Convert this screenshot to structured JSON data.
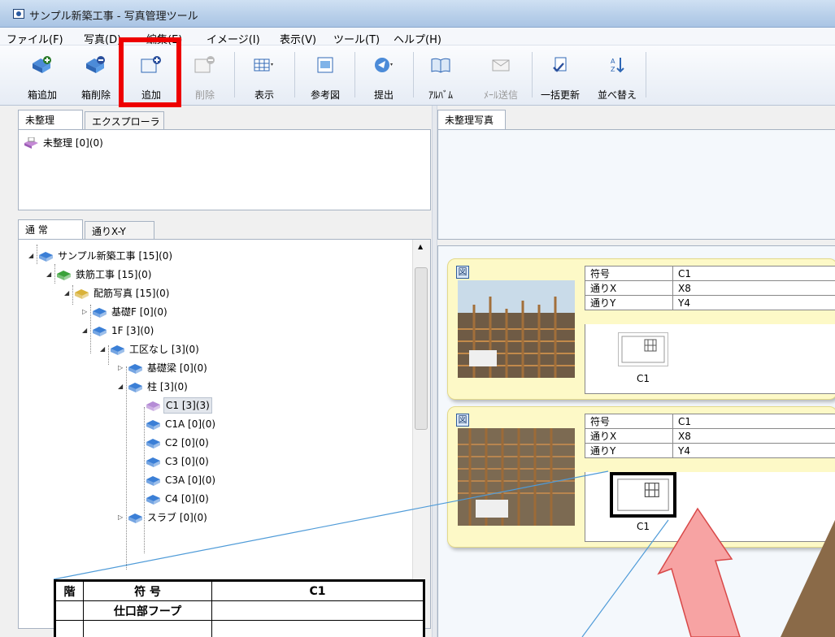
{
  "window": {
    "title": "サンプル新築工事 - 写真管理ツール"
  },
  "menu": [
    "ファイル(F)",
    "写真(D)",
    "編集(E)",
    "イメージ(I)",
    "表示(V)",
    "ツール(T)",
    "ヘルプ(H)"
  ],
  "toolbar": [
    {
      "label": "箱追加",
      "icon": "box-add-icon",
      "enabled": true
    },
    {
      "label": "箱削除",
      "icon": "box-delete-icon",
      "enabled": true
    },
    {
      "label": "追加",
      "icon": "photo-add-icon",
      "enabled": true
    },
    {
      "label": "削除",
      "icon": "photo-delete-icon",
      "enabled": false
    },
    {
      "label": "表示",
      "icon": "view-icon",
      "enabled": true
    },
    {
      "label": "参考図",
      "icon": "reference-drawing-icon",
      "enabled": true
    },
    {
      "label": "提出",
      "icon": "submit-icon",
      "enabled": true
    },
    {
      "label": "ｱﾙﾊﾞﾑ",
      "icon": "album-icon",
      "enabled": true
    },
    {
      "label": "ﾒｰﾙ送信",
      "icon": "mail-send-icon",
      "enabled": false
    },
    {
      "label": "一括更新",
      "icon": "bulk-update-icon",
      "enabled": true
    },
    {
      "label": "並べ替え",
      "icon": "sort-icon",
      "enabled": true
    }
  ],
  "left_top": {
    "tabs": [
      "未整理",
      "エクスプローラ"
    ],
    "item": "未整理 [0](0)"
  },
  "left_tree": {
    "tabs": [
      "通 常",
      "通りX-Y"
    ],
    "nodes": [
      {
        "label": "サンプル新築工事 [15](0)",
        "level": 0,
        "expanded": true,
        "color": "#3b7fd6"
      },
      {
        "label": "鉄筋工事 [15](0)",
        "level": 1,
        "expanded": true,
        "color": "#3aa23a"
      },
      {
        "label": "配筋写真 [15](0)",
        "level": 2,
        "expanded": true,
        "color": "#d9b23a"
      },
      {
        "label": "基礎F [0](0)",
        "level": 3,
        "expanded": false,
        "color": "#3b7fd6"
      },
      {
        "label": "1F [3](0)",
        "level": 3,
        "expanded": true,
        "color": "#3b7fd6"
      },
      {
        "label": "工区なし [3](0)",
        "level": 4,
        "expanded": true,
        "color": "#3b7fd6"
      },
      {
        "label": "基礎梁 [0](0)",
        "level": 5,
        "expanded": false,
        "color": "#3b7fd6"
      },
      {
        "label": "柱 [3](0)",
        "level": 5,
        "expanded": true,
        "color": "#3b7fd6"
      },
      {
        "label": "C1 [3](3)",
        "level": 6,
        "expanded": null,
        "color": "#b58cd6",
        "selected": true
      },
      {
        "label": "C1A [0](0)",
        "level": 6,
        "expanded": null,
        "color": "#3b7fd6"
      },
      {
        "label": "C2 [0](0)",
        "level": 6,
        "expanded": null,
        "color": "#3b7fd6"
      },
      {
        "label": "C3 [0](0)",
        "level": 6,
        "expanded": null,
        "color": "#3b7fd6"
      },
      {
        "label": "C3A [0](0)",
        "level": 6,
        "expanded": null,
        "color": "#3b7fd6"
      },
      {
        "label": "C4 [0](0)",
        "level": 6,
        "expanded": null,
        "color": "#3b7fd6"
      },
      {
        "label": "スラブ [0](0)",
        "level": 5,
        "expanded": false,
        "color": "#3b7fd6"
      }
    ]
  },
  "right_top": {
    "tab": "未整理写真"
  },
  "cards": [
    {
      "zu": "図",
      "rows": [
        [
          "符号",
          "C1"
        ],
        [
          "通りX",
          "X8"
        ],
        [
          "通りY",
          "Y4"
        ]
      ],
      "caption": "C1"
    },
    {
      "zu": "図",
      "rows": [
        [
          "符号",
          "C1"
        ],
        [
          "通りX",
          "X8"
        ],
        [
          "通りY",
          "Y4"
        ]
      ],
      "caption": "C1"
    }
  ],
  "popup": {
    "row1": [
      "階",
      "符 号",
      "C1"
    ],
    "row2": [
      "仕口部フープ"
    ]
  }
}
